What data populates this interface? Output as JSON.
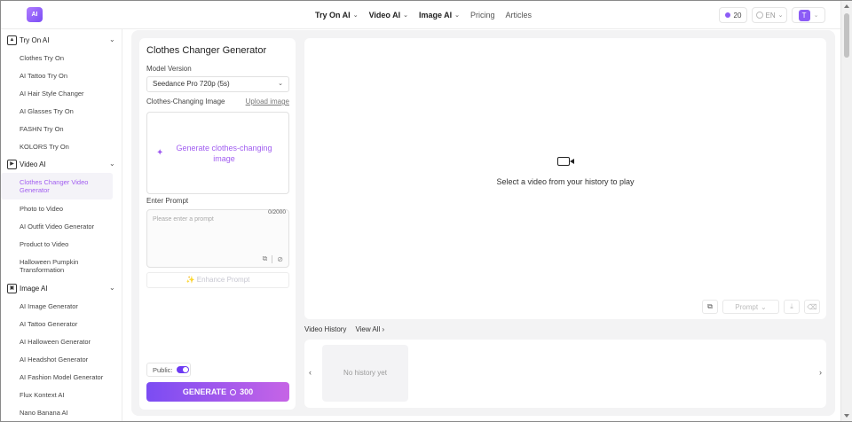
{
  "header": {
    "logo_text": "AI",
    "nav": [
      {
        "label": "Try On AI",
        "dropdown": true
      },
      {
        "label": "Video AI",
        "dropdown": true
      },
      {
        "label": "Image AI",
        "dropdown": true
      },
      {
        "label": "Pricing",
        "dropdown": false
      },
      {
        "label": "Articles",
        "dropdown": false
      }
    ],
    "credits": "20",
    "language": "EN",
    "user_initial": "T"
  },
  "sidebar": {
    "sections": [
      {
        "label": "Try On AI",
        "icon": "shirt-icon",
        "items": [
          {
            "label": "Clothes Try On"
          },
          {
            "label": "AI Tattoo Try On"
          },
          {
            "label": "AI Hair Style Changer"
          },
          {
            "label": "AI Glasses Try On"
          },
          {
            "label": "FASHN Try On"
          },
          {
            "label": "KOLORS Try On"
          }
        ]
      },
      {
        "label": "Video AI",
        "icon": "video-play-icon",
        "items": [
          {
            "label": "Clothes Changer Video Generator",
            "active": true
          },
          {
            "label": "Photo to Video"
          },
          {
            "label": "AI Outfit Video Generator"
          },
          {
            "label": "Product to Video"
          },
          {
            "label": "Halloween Pumpkin Transformation"
          }
        ]
      },
      {
        "label": "Image AI",
        "icon": "image-icon",
        "items": [
          {
            "label": "AI Image Generator"
          },
          {
            "label": "AI Tattoo Generator"
          },
          {
            "label": "AI Halloween Generator"
          },
          {
            "label": "AI Headshot Generator"
          },
          {
            "label": "AI Fashion Model Generator"
          },
          {
            "label": "Flux Kontext AI"
          },
          {
            "label": "Nano Banana AI"
          }
        ]
      }
    ]
  },
  "panel": {
    "title": "Clothes Changer Generator",
    "model_label": "Model Version",
    "model_value": "Seedance Pro 720p (5s)",
    "image_label": "Clothes-Changing Image",
    "upload_link": "Upload image",
    "dropzone_text": "Generate clothes-changing image",
    "prompt_label": "Enter Prompt",
    "prompt_placeholder": "Please enter a prompt",
    "prompt_count": "0/2000",
    "enhance_label": "Enhance Prompt",
    "public_label": "Public:",
    "public_on": true,
    "generate_label": "GENERATE",
    "generate_cost": "300"
  },
  "player": {
    "message": "Select a video from your history to play",
    "prompt_button": "Prompt"
  },
  "history": {
    "title": "Video History",
    "view_all": "View All",
    "empty": "No history yet"
  },
  "colors": {
    "accent": "#8c5cf6",
    "active_text": "#a15df0",
    "generate_start": "#7b4cf3",
    "generate_end": "#c664e6"
  }
}
